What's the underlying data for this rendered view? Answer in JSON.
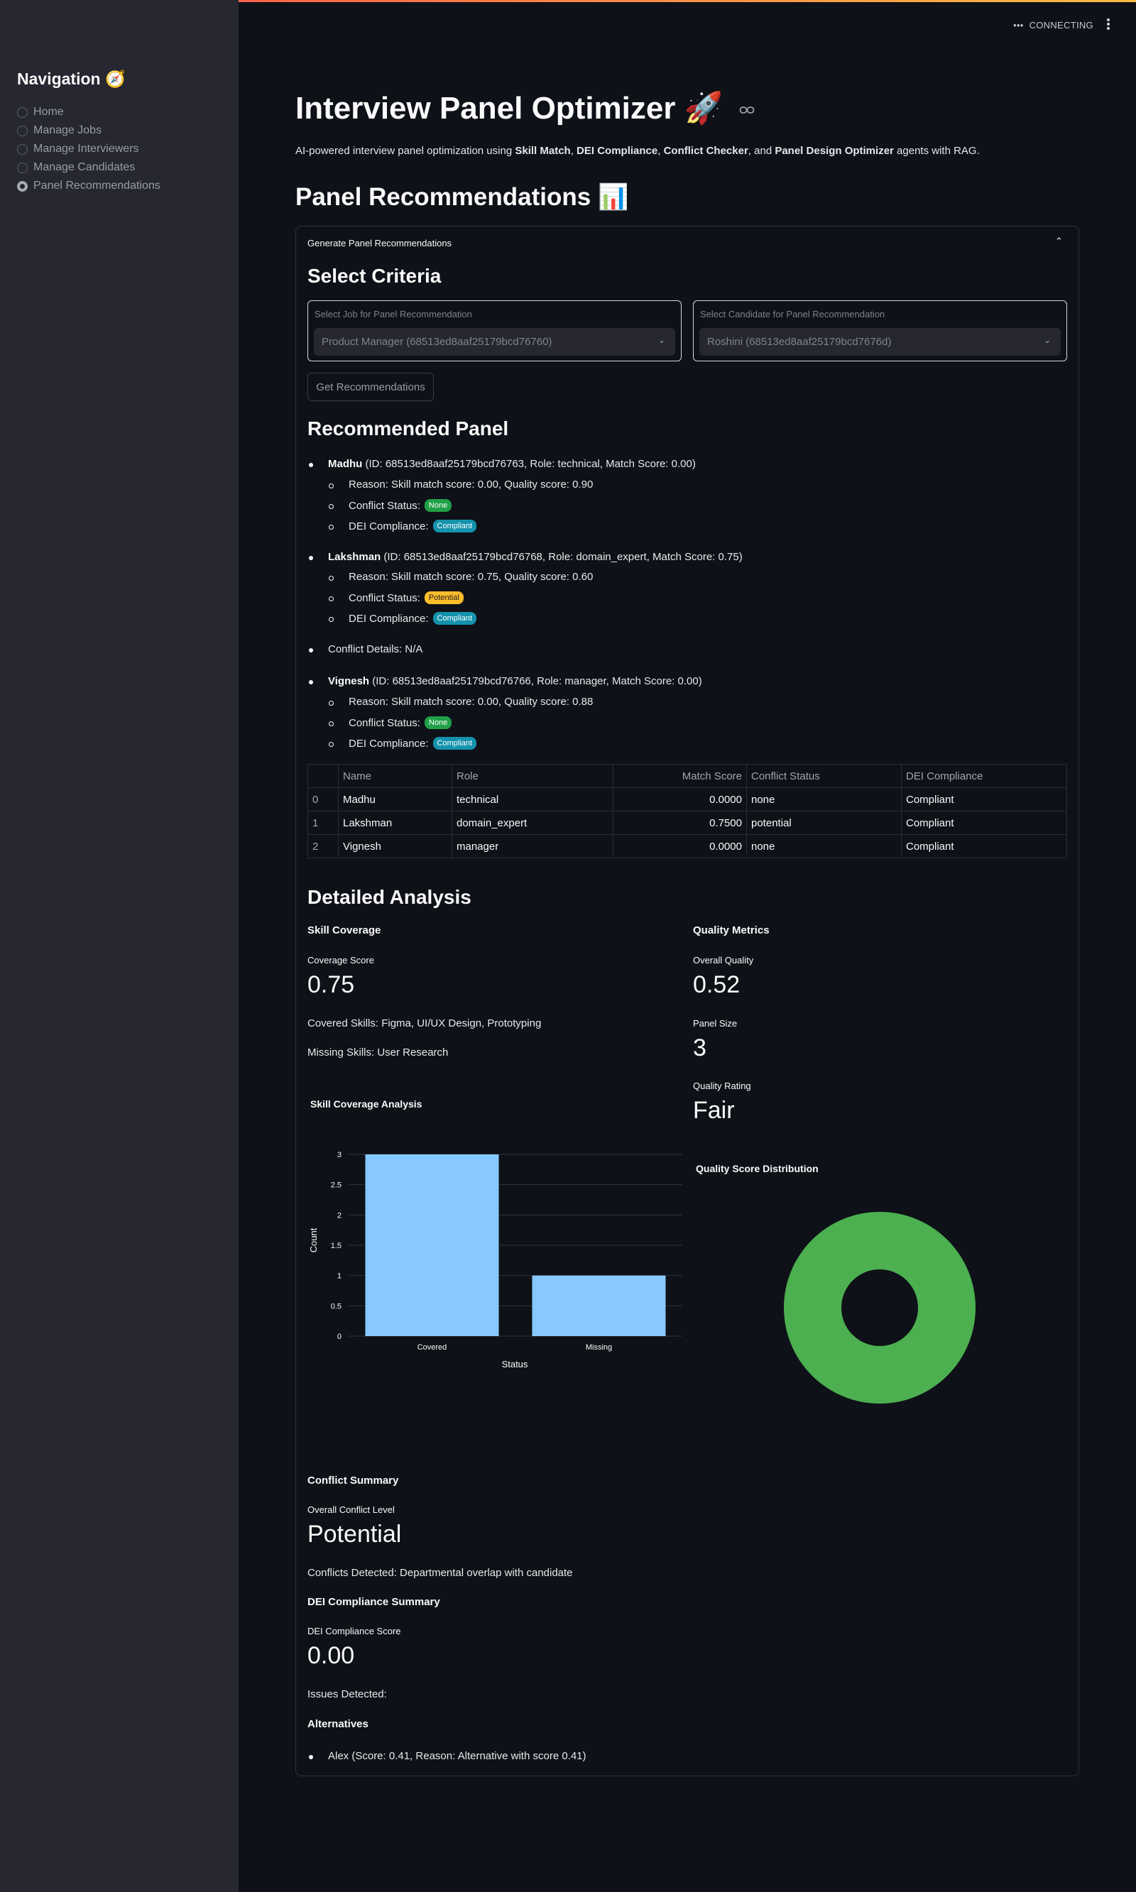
{
  "header": {
    "status": "CONNECTING"
  },
  "sidebar": {
    "title": "Navigation 🧭",
    "items": [
      {
        "label": "Home",
        "selected": false
      },
      {
        "label": "Manage Jobs",
        "selected": false
      },
      {
        "label": "Manage Interviewers",
        "selected": false
      },
      {
        "label": "Manage Candidates",
        "selected": false
      },
      {
        "label": "Panel Recommendations",
        "selected": true
      }
    ]
  },
  "main": {
    "title": "Interview Panel Optimizer 🚀",
    "subtitle": {
      "prefix": "AI-powered interview panel optimization using ",
      "a1": "Skill Match",
      "sep1": ", ",
      "a2": "DEI Compliance",
      "sep2": ", ",
      "a3": "Conflict Checker",
      "sep3": ", and ",
      "a4": "Panel Design Optimizer",
      "suffix": " agents with RAG."
    },
    "section_title": "Panel Recommendations 📊",
    "expander_label": "Generate Panel Recommendations",
    "criteria_title": "Select Criteria",
    "job_select": {
      "label": "Select Job for Panel Recommendation",
      "value": "Product Manager (68513ed8aaf25179bcd76760)"
    },
    "candidate_select": {
      "label": "Select Candidate for Panel Recommendation",
      "value": "Roshini (68513ed8aaf25179bcd7676d)"
    },
    "get_button": "Get Recommendations",
    "recommended_title": "Recommended Panel",
    "panel": [
      {
        "name": "Madhu",
        "details": "(ID: 68513ed8aaf25179bcd76763, Role: technical, Match Score: 0.00)",
        "reason": "Reason: Skill match score: 0.00, Quality score: 0.90",
        "conflict_label": "Conflict Status:",
        "conflict": "None",
        "dei_label": "DEI Compliance:",
        "dei": "Compliant"
      },
      {
        "name": "Lakshman",
        "details": "(ID: 68513ed8aaf25179bcd76768, Role: domain_expert, Match Score: 0.75)",
        "reason": "Reason: Skill match score: 0.75, Quality score: 0.60",
        "conflict_label": "Conflict Status:",
        "conflict": "Potential",
        "dei_label": "DEI Compliance:",
        "dei": "Compliant"
      },
      {
        "name": "Vignesh",
        "details": "(ID: 68513ed8aaf25179bcd76766, Role: manager, Match Score: 0.00)",
        "reason": "Reason: Skill match score: 0.00, Quality score: 0.88",
        "conflict_label": "Conflict Status:",
        "conflict": "None",
        "dei_label": "DEI Compliance:",
        "dei": "Compliant"
      }
    ],
    "conflict_details": "Conflict Details: N/A",
    "table": {
      "headers": [
        "",
        "Name",
        "Role",
        "Match Score",
        "Conflict Status",
        "DEI Compliance"
      ],
      "rows": [
        [
          "0",
          "Madhu",
          "technical",
          "0.0000",
          "none",
          "Compliant"
        ],
        [
          "1",
          "Lakshman",
          "domain_expert",
          "0.7500",
          "potential",
          "Compliant"
        ],
        [
          "2",
          "Vignesh",
          "manager",
          "0.0000",
          "none",
          "Compliant"
        ]
      ]
    },
    "analysis_title": "Detailed Analysis",
    "skill_coverage": {
      "title": "Skill Coverage",
      "score_label": "Coverage Score",
      "score": "0.75",
      "covered": "Covered Skills: Figma, UI/UX Design, Prototyping",
      "missing": "Missing Skills: User Research"
    },
    "quality": {
      "title": "Quality Metrics",
      "overall_label": "Overall Quality",
      "overall": "0.52",
      "size_label": "Panel Size",
      "size": "3",
      "rating_label": "Quality Rating",
      "rating": "Fair"
    },
    "conflict_summary": {
      "title": "Conflict Summary",
      "level_label": "Overall Conflict Level",
      "level": "Potential",
      "detected": "Conflicts Detected: Departmental overlap with candidate"
    },
    "dei_summary": {
      "title": "DEI Compliance Summary",
      "score_label": "DEI Compliance Score",
      "score": "0.00",
      "issues": "Issues Detected:"
    },
    "alternatives": {
      "title": "Alternatives",
      "items": [
        "Alex (Score: 0.41, Reason: Alternative with score 0.41)"
      ]
    }
  },
  "chart_data": [
    {
      "type": "bar",
      "title": "Skill Coverage Analysis",
      "categories": [
        "Covered",
        "Missing"
      ],
      "values": [
        3,
        1
      ],
      "xlabel": "Status",
      "ylabel": "Count",
      "ylim": [
        0,
        3
      ],
      "yticks": [
        "0",
        "0.5",
        "1",
        "1.5",
        "2",
        "2.5",
        "3"
      ],
      "color": "#87c9ff",
      "grid": true
    },
    {
      "type": "pie",
      "title": "Quality Score Distribution",
      "hole": true,
      "values": [
        1
      ],
      "color": "#4caf50"
    }
  ]
}
